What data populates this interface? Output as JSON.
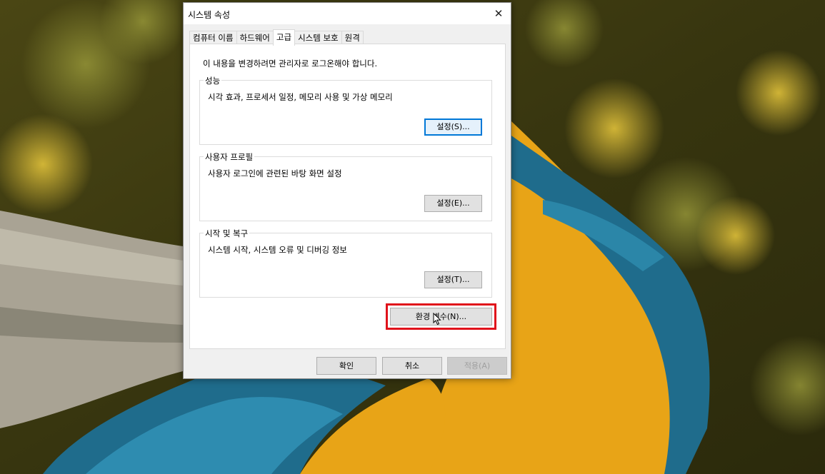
{
  "window": {
    "title": "시스템 속성",
    "close_glyph": "✕"
  },
  "tabs": [
    {
      "label": "컴퓨터 이름",
      "active": false
    },
    {
      "label": "하드웨어",
      "active": false
    },
    {
      "label": "고급",
      "active": true
    },
    {
      "label": "시스템 보호",
      "active": false
    },
    {
      "label": "원격",
      "active": false
    }
  ],
  "advanced": {
    "admin_notice": "이 내용을 변경하려면 관리자로 로그온해야 합니다.",
    "performance": {
      "title": "성능",
      "description": "시각 효과, 프로세서 일정, 메모리 사용 및 가상 메모리",
      "button": "설정(S)..."
    },
    "user_profiles": {
      "title": "사용자 프로필",
      "description": "사용자 로그인에 관련된 바탕 화면 설정",
      "button": "설정(E)..."
    },
    "startup_recovery": {
      "title": "시작 및 복구",
      "description": "시스템 시작, 시스템 오류 및 디버깅 정보",
      "button": "설정(T)..."
    },
    "env_vars_button": "환경 변수(N)..."
  },
  "footer": {
    "ok": "확인",
    "cancel": "취소",
    "apply": "적용(A)"
  },
  "colors": {
    "highlight_box": "#e0121b",
    "focus_border": "#0078d7"
  },
  "icons": {
    "close": "close-icon",
    "cursor": "mouse-pointer-icon"
  }
}
